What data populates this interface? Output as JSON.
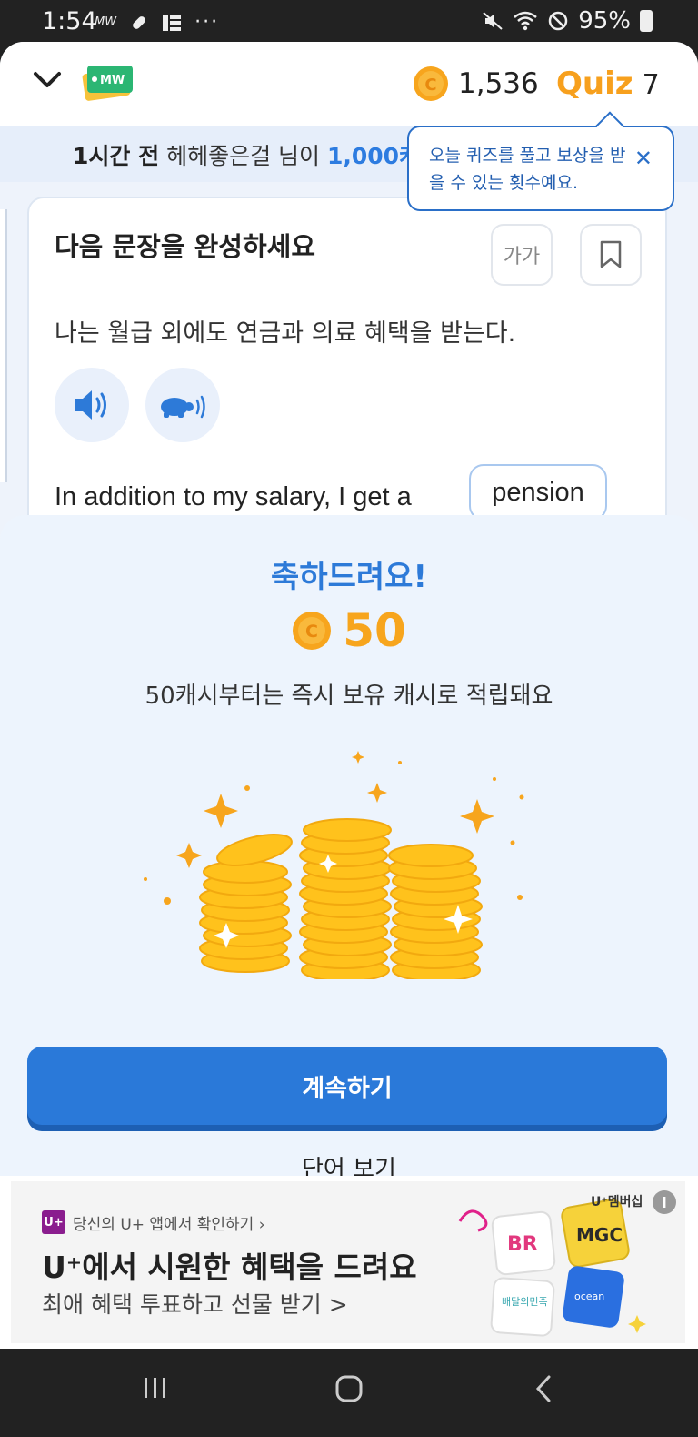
{
  "status_bar": {
    "time": "1:54",
    "left_icons": [
      "mw-icon",
      "pill-icon",
      "grid-icon",
      "more-dots-icon"
    ],
    "battery": "95%",
    "right_icons": [
      "mute-icon",
      "wifi-icon",
      "dnd-icon",
      "battery-icon"
    ]
  },
  "header": {
    "logo_text": "MW",
    "coin_count": "1,536",
    "quiz_label": "Quiz",
    "quiz_count": "7"
  },
  "notice": {
    "time": "1시간 전",
    "user": "헤헤좋은걸 님이",
    "amount": "1,000캐"
  },
  "tooltip": {
    "text": "오늘 퀴즈를 풀고 보상을 받을 수 있는 횟수예요.",
    "close": "✕"
  },
  "quiz_card": {
    "title": "다음 문장을 완성하세요",
    "font_button": "가가",
    "korean_sentence": "나는 월급 외에도 연금과 의료 혜택을 받는다.",
    "english_sentence": "In addition to my salary, I get a",
    "answer": "pension"
  },
  "reward_sheet": {
    "title": "축하드려요!",
    "amount": "50",
    "message": "50캐시부터는 즉시 보유 캐시로 적립돼요",
    "continue_label": "계속하기",
    "view_words_label": "단어 보기"
  },
  "ad": {
    "source": "당신의 U+ 앱에서 확인하기 ›",
    "source_logo": "U+",
    "title": "U⁺에서 시원한 혜택을 드려요",
    "subtitle": "최애 혜택 투표하고 선물 받기 >",
    "brand": "U⁺멤버십",
    "info": "i"
  },
  "colors": {
    "primary": "#2a79d9",
    "coin": "#f7a51d",
    "sheet_bg": "#edf4fd"
  }
}
